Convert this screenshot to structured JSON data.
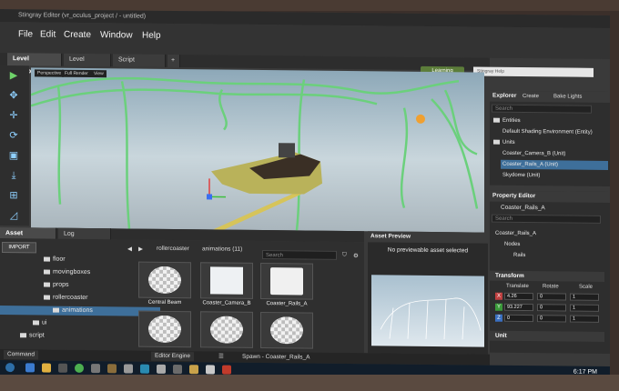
{
  "window": {
    "title": "Stingray Editor (vr_oculus_project / - untitled)"
  },
  "menu": [
    "File",
    "Edit",
    "Create",
    "Window",
    "Help"
  ],
  "tabs": [
    {
      "label": "Level Viewport",
      "close": "×"
    },
    {
      "label": "Level Flow",
      "close": "×"
    },
    {
      "label": "Script Editor",
      "close": "×"
    }
  ],
  "learning_button": "Learning",
  "mini_window_title": "Stingray Help",
  "viewport": {
    "buttons": [
      "Perspective",
      "Full Render",
      "View"
    ]
  },
  "explorer": {
    "title": "Explorer",
    "tabs": [
      "Create",
      "Bake Lights"
    ],
    "search_placeholder": "Search",
    "items": [
      {
        "label": "Entities",
        "sel": false
      },
      {
        "label": "Default Shading Environment (Entity)",
        "sel": false
      },
      {
        "label": "Units",
        "sel": false
      },
      {
        "label": "Coaster_Camera_B (Unit)",
        "sel": false
      },
      {
        "label": "Coaster_Rails_A (Unit)",
        "sel": true
      },
      {
        "label": "Skydome (Unit)",
        "sel": false
      }
    ]
  },
  "property_editor": {
    "title": "Property Editor",
    "object_name": "Coaster_Rails_A",
    "search_placeholder": "Search",
    "tree": [
      "Coaster_Rails_A",
      "Nodes",
      "Rails"
    ],
    "transform_title": "Transform",
    "columns": [
      "Translate",
      "Rotate",
      "Scale"
    ],
    "rows": [
      {
        "axis": "X",
        "translate": "4.26",
        "rotate": "0",
        "scale": "1"
      },
      {
        "axis": "Y",
        "translate": "93.227",
        "rotate": "0",
        "scale": "1"
      },
      {
        "axis": "Z",
        "translate": "0",
        "rotate": "0",
        "scale": "1"
      }
    ],
    "unit_title": "Unit"
  },
  "bottom_tabs": [
    {
      "label": "Asset Browser",
      "close": "×"
    },
    {
      "label": "Log Console",
      "close": "×"
    }
  ],
  "asset_browser": {
    "import_label": "IMPORT",
    "tree": [
      {
        "label": "floor",
        "sel": false
      },
      {
        "label": "movingboxes",
        "sel": false
      },
      {
        "label": "props",
        "sel": false
      },
      {
        "label": "rollercoaster",
        "sel": false
      },
      {
        "label": "animations",
        "sel": true
      },
      {
        "label": "ui",
        "sel": false
      },
      {
        "label": "script",
        "sel": false
      }
    ],
    "breadcrumb": [
      "rollercoaster",
      "animations (11)"
    ],
    "search_placeholder": "Search",
    "thumbs": [
      {
        "caption": "Central Beam"
      },
      {
        "caption": "Coaster_Camera_B"
      },
      {
        "caption": "Coaster_Rails_A"
      },
      {
        "caption": ""
      },
      {
        "caption": ""
      },
      {
        "caption": ""
      }
    ]
  },
  "asset_preview": {
    "title": "Asset Preview",
    "no_preview": "No previewable asset selected"
  },
  "status": {
    "mode": "Command",
    "engine": "Editor Engine",
    "spawn": "Spawn - Coaster_Rails_A"
  },
  "taskbar": {
    "time": "6:17 PM"
  }
}
